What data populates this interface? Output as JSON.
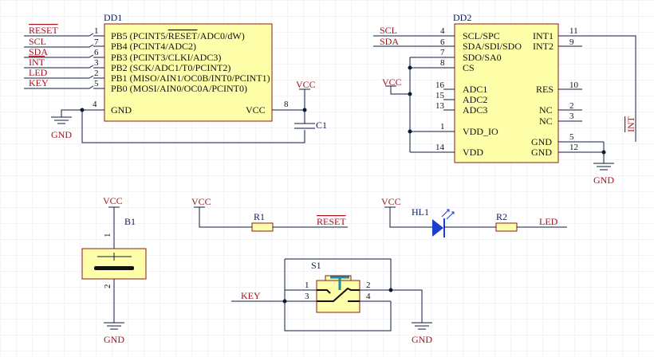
{
  "colors": {
    "wire": "#0d1b3a",
    "net": "#a3141f",
    "body": "#ffffaa",
    "body_stroke": "#8a1a1a",
    "led": "#1a3fcf",
    "switch": "#1a8ca3"
  },
  "dd1": {
    "designator": "DD1",
    "left_ports": [
      "RESET",
      "SCL",
      "SDA",
      "INT",
      "LED",
      "KEY"
    ],
    "pin_nums": [
      "1",
      "7",
      "6",
      "3",
      "2",
      "5"
    ],
    "pins_prefix": [
      "PB5 (PCINT5/",
      "PB4 (PCINT4/ADC2)",
      "PB3 (PCINT3/CLKI/ADC3)",
      "PB2 (SCK/ADC1/T0/PCINT2)",
      "PB1 (MISO/AIN1/OC0B/INT0/PCINT1)",
      "PB0 (MOSI/AIN0/OC0A/PCINT0)"
    ],
    "pin1_overline": "RESET",
    "pin1_suffix": "/ADC0/dW)",
    "gnd_label": "GND",
    "gnd_num": "4",
    "vcc_label": "VCC",
    "vcc_num": "8"
  },
  "c1": "C1",
  "dd2": {
    "designator": "DD2",
    "left_ports": [
      "SCL",
      "SDA"
    ],
    "left_pins": [
      {
        "num": "4",
        "name": "SCL/SPC"
      },
      {
        "num": "6",
        "name": "SDA/SDI/SDO"
      },
      {
        "num": "7",
        "name": "SDO/SA0"
      },
      {
        "num": "8",
        "name": "CS"
      },
      {
        "num": "16",
        "name": "ADC1"
      },
      {
        "num": "15",
        "name": "ADC2"
      },
      {
        "num": "13",
        "name": "ADC3"
      },
      {
        "num": "1",
        "name": "VDD_IO"
      },
      {
        "num": "14",
        "name": "VDD"
      }
    ],
    "right_pins": [
      {
        "num": "11",
        "name": "INT1"
      },
      {
        "num": "9",
        "name": "INT2"
      },
      {
        "num": "10",
        "name": "RES"
      },
      {
        "num": "2",
        "name": "NC"
      },
      {
        "num": "3",
        "name": "NC"
      },
      {
        "num": "5",
        "name": "GND"
      },
      {
        "num": "12",
        "name": "GND"
      }
    ],
    "int_port": "INT"
  },
  "power": {
    "vcc": "VCC",
    "gnd": "GND"
  },
  "b1": {
    "designator": "B1",
    "pin1": "1",
    "pin2": "2"
  },
  "r1": {
    "designator": "R1",
    "net": "RESET"
  },
  "hl1": {
    "designator": "HL1"
  },
  "r2": {
    "designator": "R2",
    "net": "LED"
  },
  "s1": {
    "designator": "S1",
    "pins": [
      "1",
      "2",
      "3",
      "4"
    ],
    "net": "KEY"
  }
}
